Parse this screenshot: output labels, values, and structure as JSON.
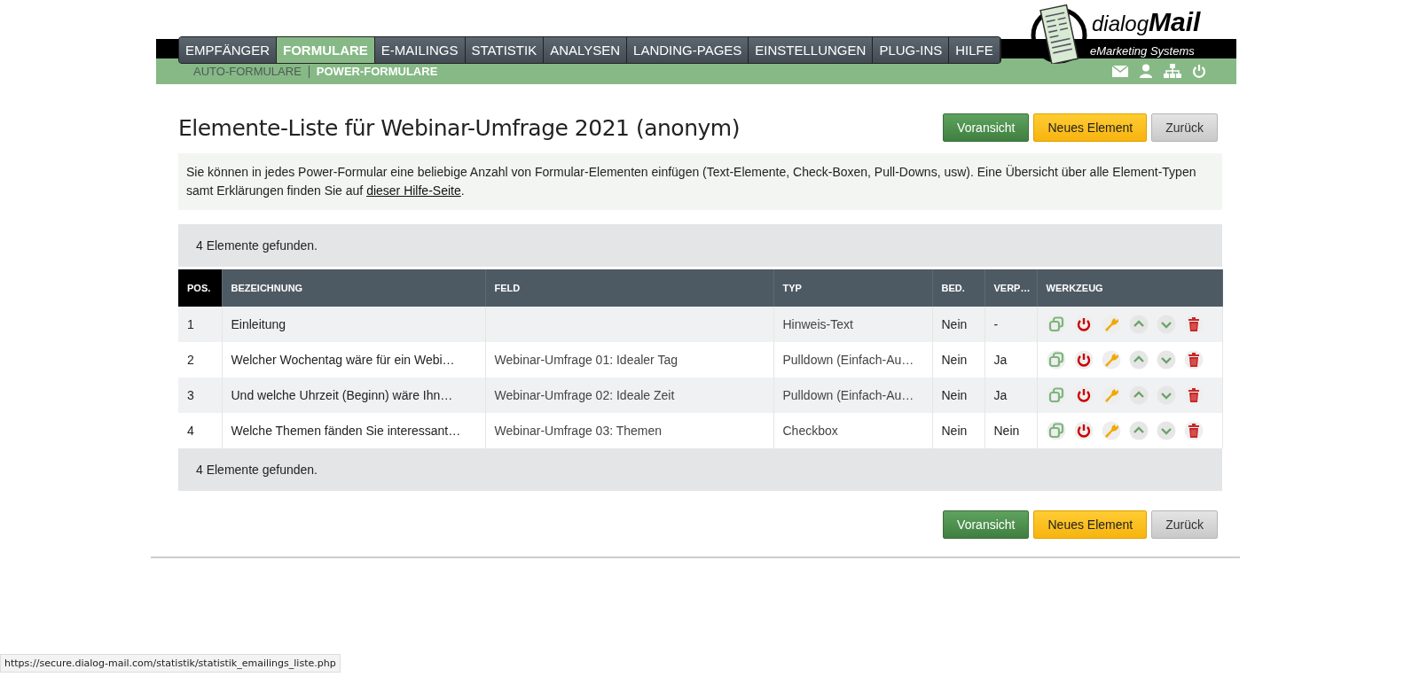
{
  "logo": {
    "word_1": "dialog",
    "word_2": "Mail",
    "tagline": "eMarketing Systems"
  },
  "nav": {
    "tabs": [
      {
        "label": "EMPFÄNGER",
        "selected": false
      },
      {
        "label": "FORMULARE",
        "selected": true
      },
      {
        "label": "E-MAILINGS",
        "selected": false
      },
      {
        "label": "STATISTIK",
        "selected": false
      },
      {
        "label": "ANALYSEN",
        "selected": false
      },
      {
        "label": "LANDING-PAGES",
        "selected": false
      },
      {
        "label": "EINSTELLUNGEN",
        "selected": false
      },
      {
        "label": "PLUG-INS",
        "selected": false
      },
      {
        "label": "HILFE",
        "selected": false
      }
    ],
    "subtabs": [
      {
        "label": "AUTO-FORMULARE",
        "selected": false
      },
      {
        "label": "POWER-FORMULARE",
        "selected": true
      }
    ]
  },
  "title": "Elemente-Liste für Webinar-Umfrage 2021 (anonym)",
  "top_buttons": [
    {
      "label": "Voransicht",
      "kind": "primary"
    },
    {
      "label": "Neues Element",
      "kind": "warning"
    },
    {
      "label": "Zurück",
      "kind": "default"
    }
  ],
  "intro": {
    "text": "Sie können in jedes Power-Formular eine beliebige Anzahl von Formular-Elementen einfügen (Text-Elemente, Check-Boxen, Pull-Downs, usw). Eine Übersicht über alle Element-Typen samt Erklärungen finden Sie auf ",
    "link": "dieser Hilfe-Seite",
    "after": "."
  },
  "count_top": "4 Elemente gefunden.",
  "table": {
    "columns": [
      {
        "label": "POS.",
        "sorted": true
      },
      {
        "label": "BEZEICHNUNG",
        "sorted": false
      },
      {
        "label": "FELD",
        "sorted": false
      },
      {
        "label": "TYP",
        "sorted": false
      },
      {
        "label": "BED.",
        "sorted": false
      },
      {
        "label": "VERP…",
        "sorted": false
      },
      {
        "label": "WERKZEUG",
        "sorted": false
      }
    ],
    "rows": [
      [
        "1",
        "Einleitung",
        "",
        "Hinweis-Text",
        "Nein",
        "-"
      ],
      [
        "2",
        "Welcher Wochentag wäre für ein Webi…",
        "Webinar-Umfrage 01: Idealer Tag",
        "Pulldown (Einfach-Au…",
        "Nein",
        "Ja"
      ],
      [
        "3",
        "Und welche Uhrzeit (Beginn) wäre Ihn…",
        "Webinar-Umfrage 02: Ideale Zeit",
        "Pulldown (Einfach-Au…",
        "Nein",
        "Ja"
      ],
      [
        "4",
        "Welche Themen fänden Sie interessant…",
        "Webinar-Umfrage 03: Themen",
        "Checkbox",
        "Nein",
        "Nein"
      ]
    ]
  },
  "count_bottom": "4 Elemente gefunden.",
  "bottom_buttons": [
    {
      "label": "Voransicht",
      "kind": "primary"
    },
    {
      "label": "Neues Element",
      "kind": "warning"
    },
    {
      "label": "Zurück",
      "kind": "default"
    }
  ],
  "status_bar": "https://secure.dialog-mail.com/statistik/statistik_emailings_liste.php"
}
